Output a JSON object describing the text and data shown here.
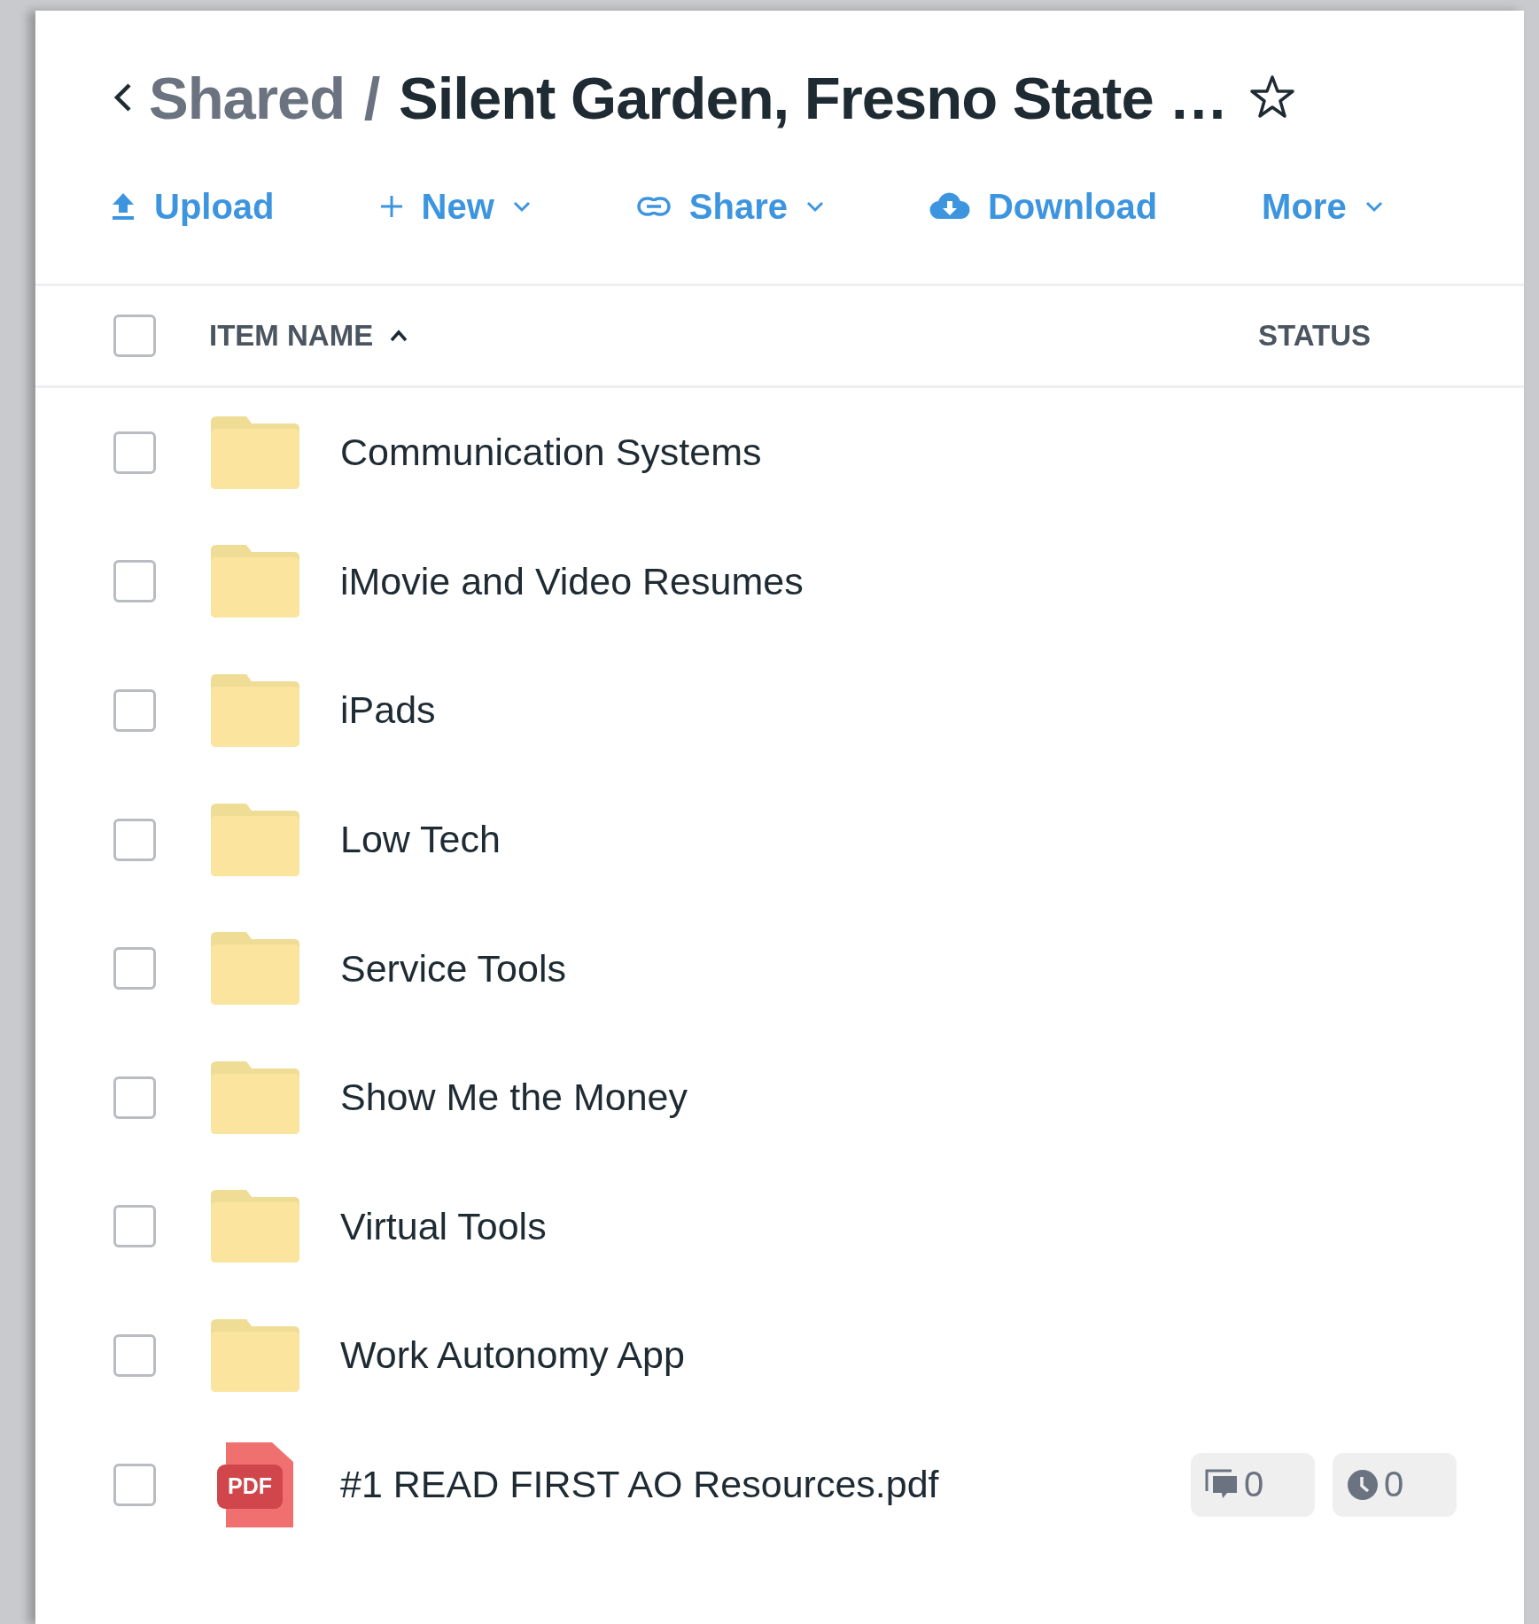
{
  "breadcrumb": {
    "parent": "Shared",
    "separator": "/",
    "current": "Silent Garden, Fresno State …",
    "starred": false
  },
  "toolbar": [
    {
      "kind": "upload",
      "label": "Upload",
      "dropdown": false
    },
    {
      "kind": "new",
      "label": "New",
      "dropdown": true
    },
    {
      "kind": "share",
      "label": "Share",
      "dropdown": true
    },
    {
      "kind": "download",
      "label": "Download",
      "dropdown": false
    },
    {
      "kind": "more",
      "label": "More",
      "dropdown": true
    }
  ],
  "table": {
    "select_all": {
      "checked": false
    },
    "columns": [
      {
        "label": "ITEM NAME",
        "sorted": true
      },
      {
        "label": "STATUS",
        "sorted": false
      }
    ],
    "rows": [
      {
        "kind": "folder",
        "name": "Communication Systems",
        "checked": false
      },
      {
        "kind": "folder",
        "name": "iMovie and Video Resumes",
        "checked": false
      },
      {
        "kind": "folder",
        "name": "iPads",
        "checked": false
      },
      {
        "kind": "folder",
        "name": "Low Tech",
        "checked": false
      },
      {
        "kind": "folder",
        "name": "Service Tools",
        "checked": false
      },
      {
        "kind": "folder",
        "name": "Show Me the Money",
        "checked": false
      },
      {
        "kind": "folder",
        "name": "Virtual Tools",
        "checked": false
      },
      {
        "kind": "folder",
        "name": "Work Autonomy App",
        "checked": false
      },
      {
        "kind": "pdf",
        "badge": "PDF",
        "name": "#1 READ FIRST AO Resources.pdf",
        "checked": false,
        "status": {
          "comments": "0",
          "tasks": "0"
        }
      }
    ]
  }
}
